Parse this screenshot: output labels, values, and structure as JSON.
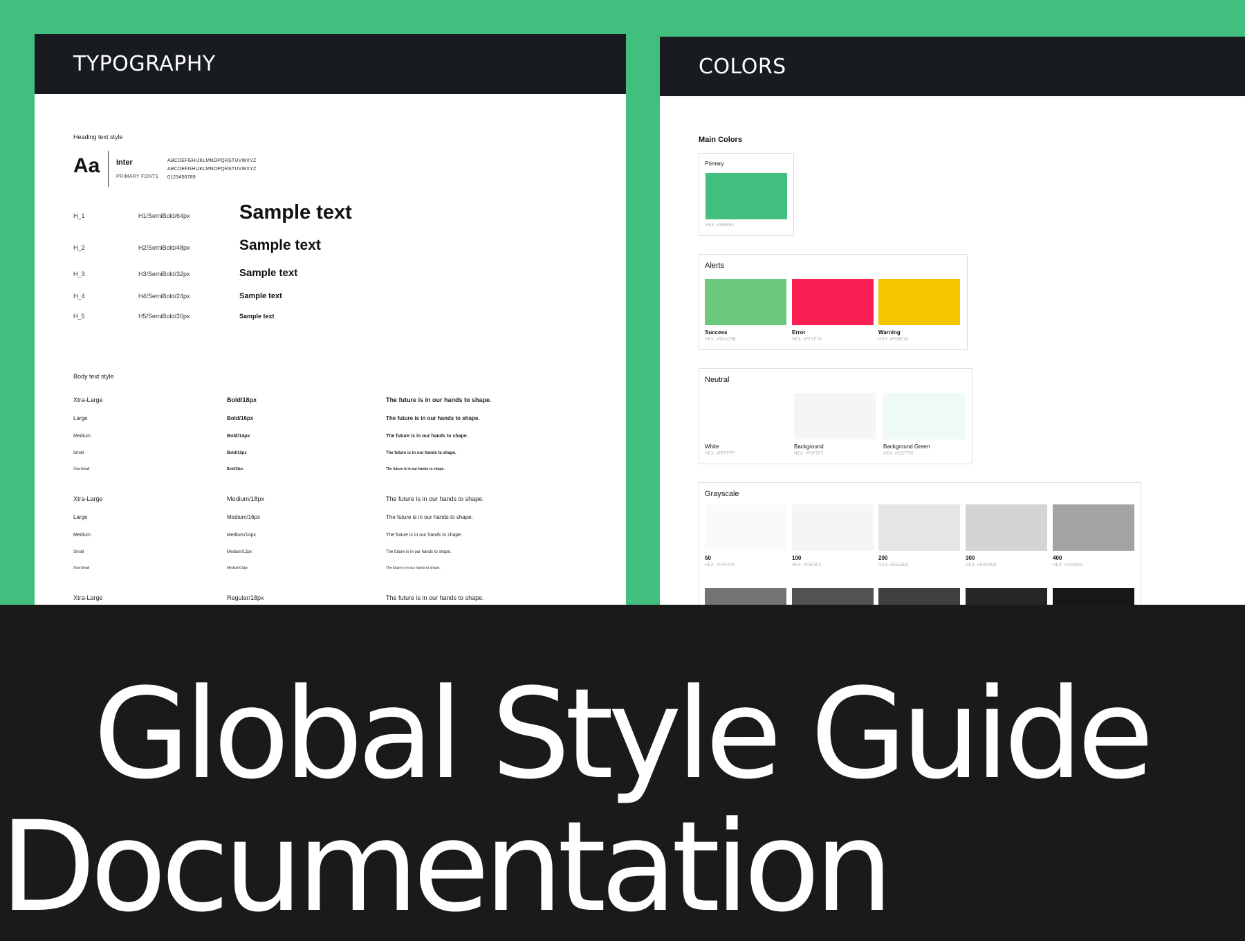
{
  "typography": {
    "header": "TYPOGRAPHY",
    "heading_section_label": "Heading text style",
    "aa": "Aa",
    "font_name": "Inter",
    "font_role": "PRIMARY FONTS",
    "font_samples": [
      "ABCDEFGHIJKLMNOPQRSTUVWXYZ",
      "ABCDEFGHIJKLMNOPQRSTUVWXYZ",
      "0123456789"
    ],
    "headings": [
      {
        "label": "H_1",
        "spec": "H1/SemiBold/64px",
        "sample": "Sample text"
      },
      {
        "label": "H_2",
        "spec": "H2/SemiBold/48px",
        "sample": "Sample text"
      },
      {
        "label": "H_3",
        "spec": "H3/SemiBold/32px",
        "sample": "Sample text"
      },
      {
        "label": "H_4",
        "spec": "H4/SemiBold/24px",
        "sample": "Sample text"
      },
      {
        "label": "H_5",
        "spec": "H5/SemiBold/20px",
        "sample": "Sample text"
      }
    ],
    "body_section_label": "Body text style",
    "body_groups": [
      [
        {
          "size": "Xtra-Large",
          "spec": "Bold/18px",
          "sample": "The future is in our hands to shape."
        },
        {
          "size": "Large",
          "spec": "Bold/16px",
          "sample": "The future is in our hands to shape."
        },
        {
          "size": "Medium",
          "spec": "Bold/14px",
          "sample": "The future is in our hands to shape."
        },
        {
          "size": "Small",
          "spec": "Bold/12px",
          "sample": "The future is in our hands to shape."
        },
        {
          "size": "Xtra-Small",
          "spec": "Bold/10px",
          "sample": "The future is in our hands to shape."
        }
      ],
      [
        {
          "size": "Xtra-Large",
          "spec": "Medium/18px",
          "sample": "The future is in our hands to shape."
        },
        {
          "size": "Large",
          "spec": "Medium/16px",
          "sample": "The future is in our hands to shape."
        },
        {
          "size": "Medium",
          "spec": "Medium/14px",
          "sample": "The future is in our hands to shape."
        },
        {
          "size": "Small",
          "spec": "Medium/12px",
          "sample": "The future is in our hands to shape."
        },
        {
          "size": "Xtra-Small",
          "spec": "Medium/10px",
          "sample": "The future is in our hands to shape."
        }
      ],
      [
        {
          "size": "Xtra-Large",
          "spec": "Regular/18px",
          "sample": "The future is in our hands to shape."
        }
      ]
    ]
  },
  "colors": {
    "header": "COLORS",
    "main_title": "Main Colors",
    "primary": {
      "title": "Primary",
      "hex_label": "HEX: #3EBF80",
      "color": "#41BF7F"
    },
    "alerts": {
      "title": "Alerts",
      "items": [
        {
          "name": "Success",
          "hex_label": "HEX: #5DAC5B",
          "color": "#6BC97D"
        },
        {
          "name": "Error",
          "hex_label": "HEX: #FF1F7D",
          "color": "#FA1F55"
        },
        {
          "name": "Warning",
          "hex_label": "HEX: #F5BE30",
          "color": "#F5C500"
        }
      ]
    },
    "neutral": {
      "title": "Neutral",
      "items": [
        {
          "name": "White",
          "hex_label": "HEX: #FFFFFF",
          "color": "#FFFFFF"
        },
        {
          "name": "Background",
          "hex_label": "HEX: #F5F5F5",
          "color": "#F5F5F5"
        },
        {
          "name": "Background Green",
          "hex_label": "HEX: #ECF7F0",
          "color": "#F0FAF4"
        }
      ]
    },
    "grayscale": {
      "title": "Grayscale",
      "items": [
        {
          "name": "50",
          "hex_label": "HEX: #FAFAFA",
          "color": "#FAFAFA"
        },
        {
          "name": "100",
          "hex_label": "HEX: #F5F5F5",
          "color": "#F5F5F5"
        },
        {
          "name": "200",
          "hex_label": "HEX: #E5E5E5",
          "color": "#E5E5E5"
        },
        {
          "name": "300",
          "hex_label": "HEX: #D4D4D4",
          "color": "#D4D4D4"
        },
        {
          "name": "400",
          "hex_label": "HEX: #A3A3A3",
          "color": "#A3A3A3"
        }
      ],
      "row2_colors": [
        "#737373",
        "#525252",
        "#404040",
        "#262626",
        "#171717"
      ]
    }
  },
  "title": {
    "line1": "Global Style Guide",
    "line2": "Documentation"
  }
}
